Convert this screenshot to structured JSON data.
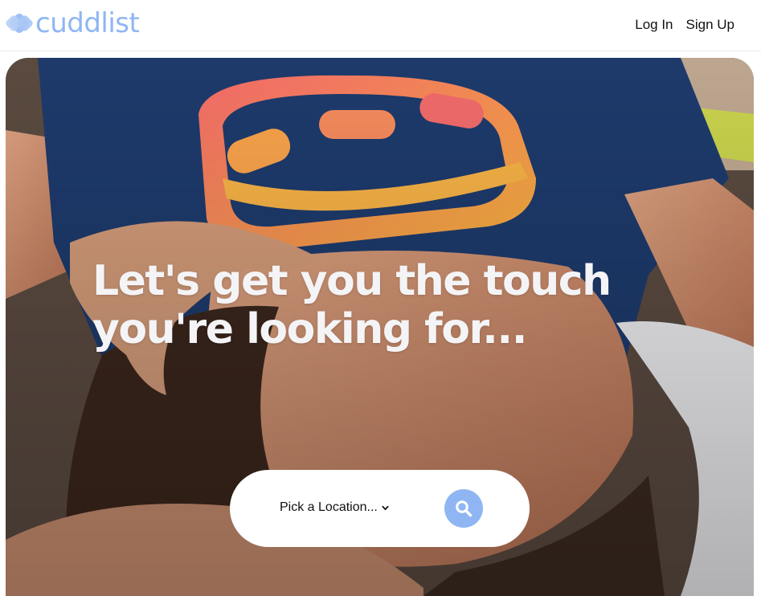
{
  "brand": {
    "name": "cuddlist",
    "color": "#8fb6f3"
  },
  "nav": {
    "login_label": "Log In",
    "signup_label": "Sign Up"
  },
  "hero": {
    "headline_line1": "Let's get you the touch",
    "headline_line2": "you're looking for...",
    "image_subject": "photo of a couple cuddling on a couch"
  },
  "search": {
    "location_label": "Pick a Location...",
    "location_icon": "chevron-down-icon",
    "button_icon": "search-icon",
    "button_color": "#8fb6f3"
  }
}
